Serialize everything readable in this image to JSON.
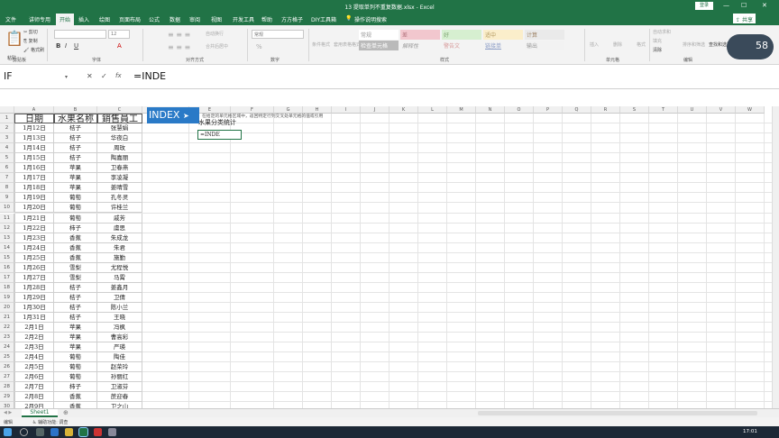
{
  "window": {
    "title": "13 提取单列不重复数据.xlsx - Excel",
    "login": "登录",
    "share": "共享",
    "win_min": "—",
    "win_max": "☐",
    "win_close": "✕"
  },
  "menu": {
    "tabs": [
      "文件",
      "讲师专用",
      "开始",
      "插入",
      "绘图",
      "页面布局",
      "公式",
      "数据",
      "审阅",
      "视图",
      "开发工具",
      "帮助",
      "方方格子",
      "DIY工具箱"
    ],
    "active": "开始",
    "search": "操作说明搜索"
  },
  "ribbon": {
    "paste": "粘贴",
    "cut": "剪切",
    "copy": "复制",
    "format_painter": "格式刷",
    "font_name": "",
    "font_size": "12",
    "bold": "B",
    "italic": "I",
    "underline": "U",
    "font_btn": "A",
    "wrap": "自动换行",
    "merge": "合并后居中",
    "number_format": "常规",
    "percent": "%",
    "cond_format": "条件格式",
    "table_format": "套用表格格式",
    "styles": [
      "常规",
      "差",
      "好",
      "适中",
      "计算"
    ],
    "styles2": [
      "检查单元格",
      "解释性",
      "警告文",
      "链接单",
      "输出"
    ],
    "insert": "插入",
    "delete": "删除",
    "format": "格式",
    "autosum": "自动求和",
    "fill": "填充",
    "clear": "清除",
    "sort": "排序和筛选",
    "find": "查找和选择",
    "groups": [
      "剪贴板",
      "字体",
      "对齐方式",
      "数字",
      "样式",
      "单元格",
      "编辑"
    ]
  },
  "formula_bar": {
    "name_box": "IF",
    "cancel": "✕",
    "enter": "✓",
    "fx": "fx",
    "formula": "=INDE"
  },
  "columns": [
    "A",
    "B",
    "C",
    "D",
    "E",
    "F",
    "G",
    "H",
    "I",
    "J",
    "K",
    "L",
    "M",
    "N",
    "O",
    "P",
    "Q",
    "R",
    "S",
    "T",
    "U",
    "V",
    "W"
  ],
  "table": {
    "headers": [
      "日期",
      "水果名称",
      "銷售員工"
    ],
    "rows": [
      [
        "1月12日",
        "桔子",
        "张慧娟"
      ],
      [
        "1月13日",
        "桔子",
        "华夜白"
      ],
      [
        "1月14日",
        "桔子",
        "周玫"
      ],
      [
        "1月15日",
        "桔子",
        "陶嘉丽"
      ],
      [
        "1月16日",
        "苹果",
        "卫春燕"
      ],
      [
        "1月17日",
        "苹果",
        "李凌凝"
      ],
      [
        "1月18日",
        "苹果",
        "姜晴雪"
      ],
      [
        "1月19日",
        "葡萄",
        "孔冬灵"
      ],
      [
        "1月20日",
        "葡萄",
        "许桂兰"
      ],
      [
        "1月21日",
        "葡萄",
        "戚芳"
      ],
      [
        "1月22日",
        "柿子",
        "虞思"
      ],
      [
        "1月23日",
        "香蕉",
        "朱成龙"
      ],
      [
        "1月24日",
        "香蕉",
        "朱君"
      ],
      [
        "1月25日",
        "香蕉",
        "施勤"
      ],
      [
        "1月26日",
        "雪梨",
        "尤程悦"
      ],
      [
        "1月27日",
        "雪梨",
        "马霄"
      ],
      [
        "1月28日",
        "桔子",
        "姜鑫月"
      ],
      [
        "1月29日",
        "桔子",
        "卫倩"
      ],
      [
        "1月30日",
        "桔子",
        "陈小兰"
      ],
      [
        "1月31日",
        "桔子",
        "王晓"
      ],
      [
        "2月1日",
        "苹果",
        "冯枫"
      ],
      [
        "2月2日",
        "苹果",
        "曹高彩"
      ],
      [
        "2月3日",
        "苹果",
        "严瑛"
      ],
      [
        "2月4日",
        "葡萄",
        "陶佳"
      ],
      [
        "2月5日",
        "葡萄",
        "赵荣玲"
      ],
      [
        "2月6日",
        "葡萄",
        "孙丽红"
      ],
      [
        "2月7日",
        "柿子",
        "卫淑芬"
      ],
      [
        "2月8日",
        "香蕉",
        "蔗迎春"
      ],
      [
        "2月9日",
        "香蕉",
        "卫之山"
      ]
    ]
  },
  "autocomplete": {
    "name": "INDEX",
    "description": "在给定的单元格区域中，返回特定行列交叉处单元格的值或引用"
  },
  "summary_header": "水果分类统计",
  "editing_cell": "=INDE",
  "sheet": {
    "tab": "Sheet1",
    "add": "⊕"
  },
  "status": {
    "mode": "编辑",
    "accessibility": "辅助功能: 调查"
  },
  "taskbar": {
    "time": "17:01"
  },
  "overlay": {
    "speed": "58"
  }
}
